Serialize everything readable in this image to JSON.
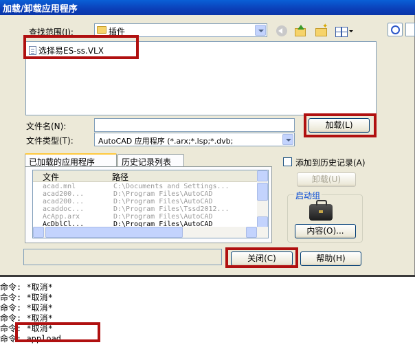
{
  "dialog": {
    "title": "加载/卸载应用程序",
    "look_in": {
      "label": "查找范围(I):",
      "value": "插件"
    },
    "file_item": "选择易ES-ss.VLX",
    "file_name": {
      "label": "文件名(N):",
      "value": ""
    },
    "file_type": {
      "label": "文件类型(T):",
      "value": "AutoCAD 应用程序 (*.arx;*.lsp;*.dvb;"
    },
    "load_button": "加载(L)",
    "tabs": [
      "已加载的应用程序",
      "历史记录列表"
    ],
    "add_to_history": "添加到历史记录(A)",
    "unload_button": "卸载(U)",
    "startup_group": {
      "title": "启动组",
      "contents_button": "内容(O)..."
    },
    "close_button": "关闭(C)",
    "help_button": "帮助(H)"
  },
  "app_table": {
    "columns": [
      "文件",
      "路径"
    ],
    "rows": [
      {
        "file": "acad.mnl",
        "path": "C:\\Documents and Settings..."
      },
      {
        "file": "acad200...",
        "path": "D:\\Program Files\\AutoCAD"
      },
      {
        "file": "acad200...",
        "path": "D:\\Program Files\\AutoCAD"
      },
      {
        "file": "acaddoc...",
        "path": "D:\\Program Files\\Tssd2012..."
      },
      {
        "file": "AcApp.arx",
        "path": "D:\\Program Files\\AutoCAD"
      },
      {
        "file": "AcDblCl...",
        "path": "D:\\Program Files\\AutoCAD"
      }
    ]
  },
  "console": {
    "lines": [
      "命令: *取消*",
      "命令: *取消*",
      "命令: *取消*",
      "命令: *取消*",
      "命令: *取消*",
      "命令: appload"
    ]
  },
  "icons": [
    "folder-icon",
    "back-arrow-icon",
    "up-folder-icon",
    "new-folder-icon",
    "views-menu-icon",
    "search-web-icon",
    "tools-icon",
    "file-icon",
    "briefcase-icon"
  ],
  "colors": {
    "titlebar": "#0b3fb8",
    "highlight": "#b01010",
    "dialog_bg": "#ece9d8"
  }
}
